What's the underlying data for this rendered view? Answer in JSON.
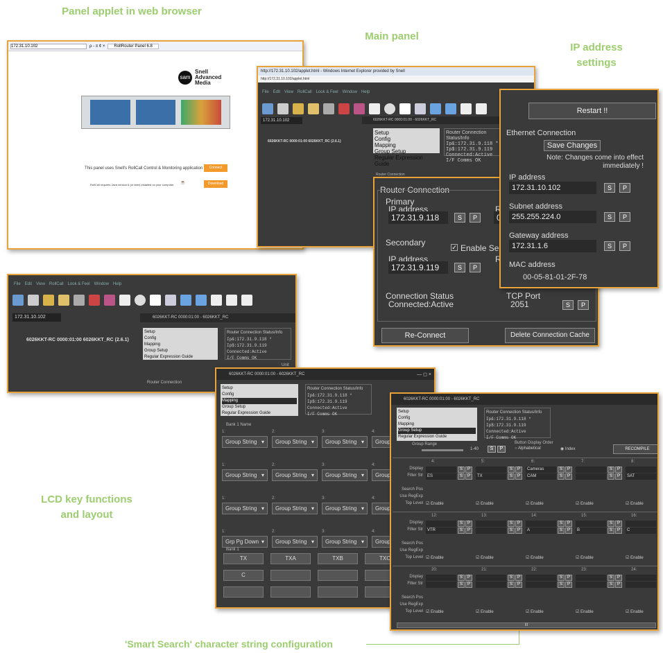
{
  "captions": {
    "browser": "Panel applet in web browser",
    "main": "Main panel",
    "ip": "IP address settings",
    "lcd": "LCD key functions and layout",
    "smart": "'Smart Search' character string configuration"
  },
  "browser": {
    "address": "172.31.10.102",
    "address_ctrl": "ρ - ≡ ¢ ×",
    "tab": "RollRouter Panel 6.8",
    "brand": [
      "Snell",
      "Advanced",
      "Media"
    ],
    "text1": "This panel uses Snell's RollCall Control & Monitoring application",
    "connect": "Connect",
    "text2": "RollCall requires Java version 6 (or later) installed on your computer",
    "download": "Download"
  },
  "main": {
    "title": "http://172.31.10.102/applet.html - Windows Internet Explorer provided by Snell",
    "url": "http://172.31.10.102/applet.html",
    "menu": [
      "File",
      "Edit",
      "View",
      "RollCall",
      "Look & Feel",
      "Window",
      "Help"
    ],
    "ip": "172.31.10.102",
    "tree": "6026KKT-RC 0000:01:00 6026KKT_RC (2.6.1)",
    "panel_title": "6026KKT-RC 0000:01:00 - 6026KKT_RC",
    "nav": [
      "Setup",
      "Config",
      "Mapping",
      "Group Setup",
      "Regular Expression Guide"
    ],
    "status_title": "Router Connection Status/Info",
    "status_lines": [
      "Ip&:172.31.9.118 *",
      "Ip$:172.31.9.119",
      "Connected:Active",
      "I/F Comms OK"
    ],
    "router_connection": "Router Connection",
    "primary": "Primary",
    "ip_label": "IP address",
    "primary_ip": "172.31.9.118",
    "secondary": "Secondary",
    "enable_secondary": "Enable Secondary Co",
    "secondary_ip": "172.31.9.119",
    "conn_status": "Connection Status",
    "conn_value": "Connected:Active",
    "tcp_port": "TCP Port",
    "tcp_value": "2051",
    "reconnect": "Re-Connect",
    "delete_cache": "Delete Connection Cache",
    "unit": "Unit",
    "s": "S",
    "p": "P"
  },
  "ipset": {
    "restart": "Restart !!",
    "eth": "Ethernet Connection",
    "save": "Save Changes",
    "note": "Note: Changes come into effect immediately !",
    "ip_label": "IP address",
    "ip": "172.31.10.102",
    "subnet_label": "Subnet address",
    "subnet": "255.255.224.0",
    "gw_label": "Gateway address",
    "gw": "172.31.1.6",
    "mac_label": "MAC address",
    "mac": "00-05-81-01-2F-78"
  },
  "lcd": {
    "bank_name": "Bank 1 Name",
    "bank": "Bank 1",
    "rows": [
      [
        "Group String",
        "Group String",
        "Group String",
        "Group String"
      ],
      [
        "Group String",
        "Group String",
        "Group String",
        "Group String"
      ],
      [
        "Group String",
        "Group String",
        "Group String",
        "Group String"
      ],
      [
        "Grp Pg Down",
        "Group String",
        "Group String",
        "Group String"
      ]
    ],
    "nums": [
      "1:",
      "2:",
      "3:",
      "4:"
    ],
    "keys": [
      "TX",
      "TXA",
      "TXB",
      "TXC"
    ],
    "key_c": "C"
  },
  "smart": {
    "group_range": "Group Range",
    "range": "1-40",
    "button_order": "Button Display Order",
    "alphabetical": "Alphabetical",
    "index": "Index",
    "recompile": "RECOMPILE",
    "display": "Display",
    "filter": "Filter Str",
    "search_pos": "Search Pos",
    "use_regexp": "Use RegExp",
    "top_level": "Top Level",
    "enable": "Enable",
    "rows": [
      {
        "nums": [
          "4:",
          "5:",
          "6:",
          "7:",
          "8:"
        ],
        "filters": [
          "ES",
          "TX",
          "CAM",
          "",
          "SAT"
        ],
        "display": [
          "",
          "",
          "Cameras",
          "",
          ""
        ]
      },
      {
        "nums": [
          "12:",
          "13:",
          "14:",
          "15:",
          "16:"
        ],
        "filters": [
          "VTR",
          "",
          "A",
          "B",
          "C"
        ],
        "display": [
          "",
          "",
          "",
          "",
          ""
        ]
      },
      {
        "nums": [
          "20:",
          "21:",
          "22:",
          "23:",
          "24:"
        ],
        "filters": [
          "",
          "",
          "",
          "",
          ""
        ],
        "display": [
          "",
          "",
          "",
          "",
          ""
        ]
      }
    ],
    "scroll": "III"
  }
}
